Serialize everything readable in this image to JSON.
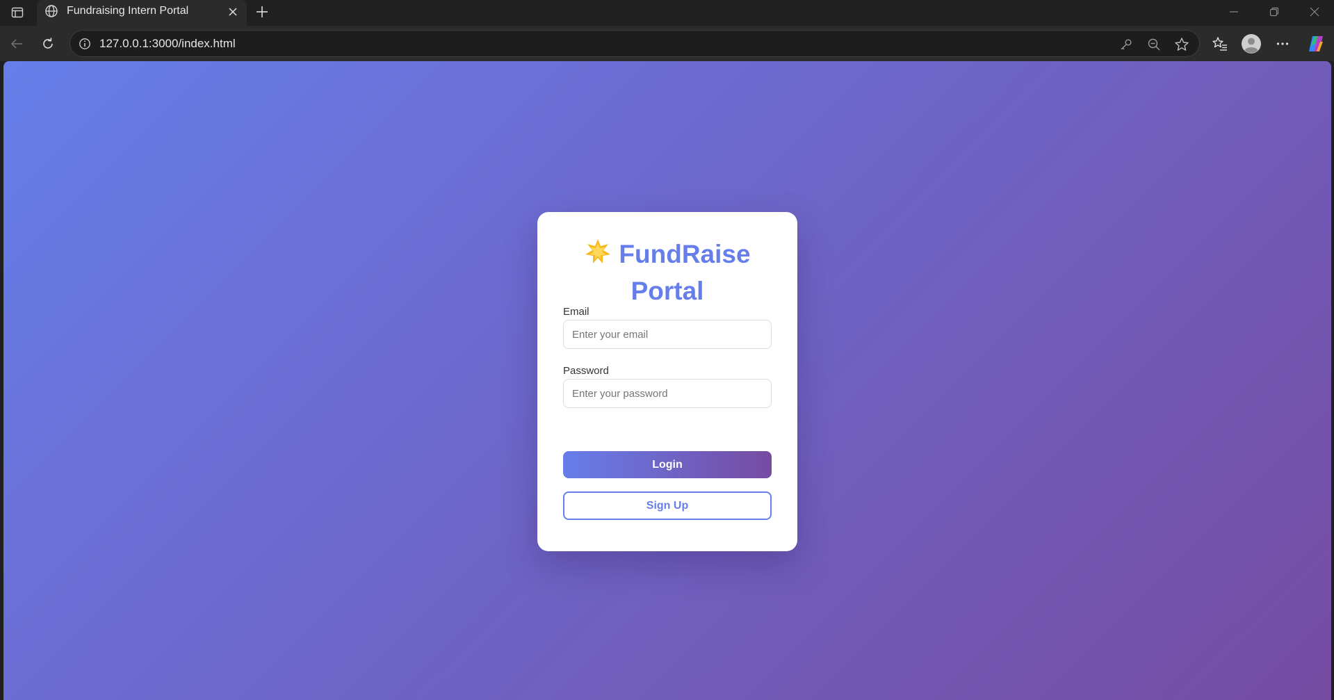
{
  "browser": {
    "tab": {
      "title": "Fundraising Intern Portal",
      "icon": "globe-icon"
    },
    "url": "127.0.0.1:3000/index.html"
  },
  "page": {
    "colors": {
      "gradient_start": "#667eea",
      "gradient_end": "#764ba2",
      "card": "#ffffff",
      "accent": "#667eea"
    },
    "login_card": {
      "logo_icon": "star-icon",
      "title_line1": "FundRaise",
      "title_line2": "Portal",
      "email": {
        "label": "Email",
        "placeholder": "Enter your email",
        "value": ""
      },
      "password": {
        "label": "Password",
        "placeholder": "Enter your password",
        "value": ""
      },
      "login_label": "Login",
      "signup_label": "Sign Up"
    }
  }
}
